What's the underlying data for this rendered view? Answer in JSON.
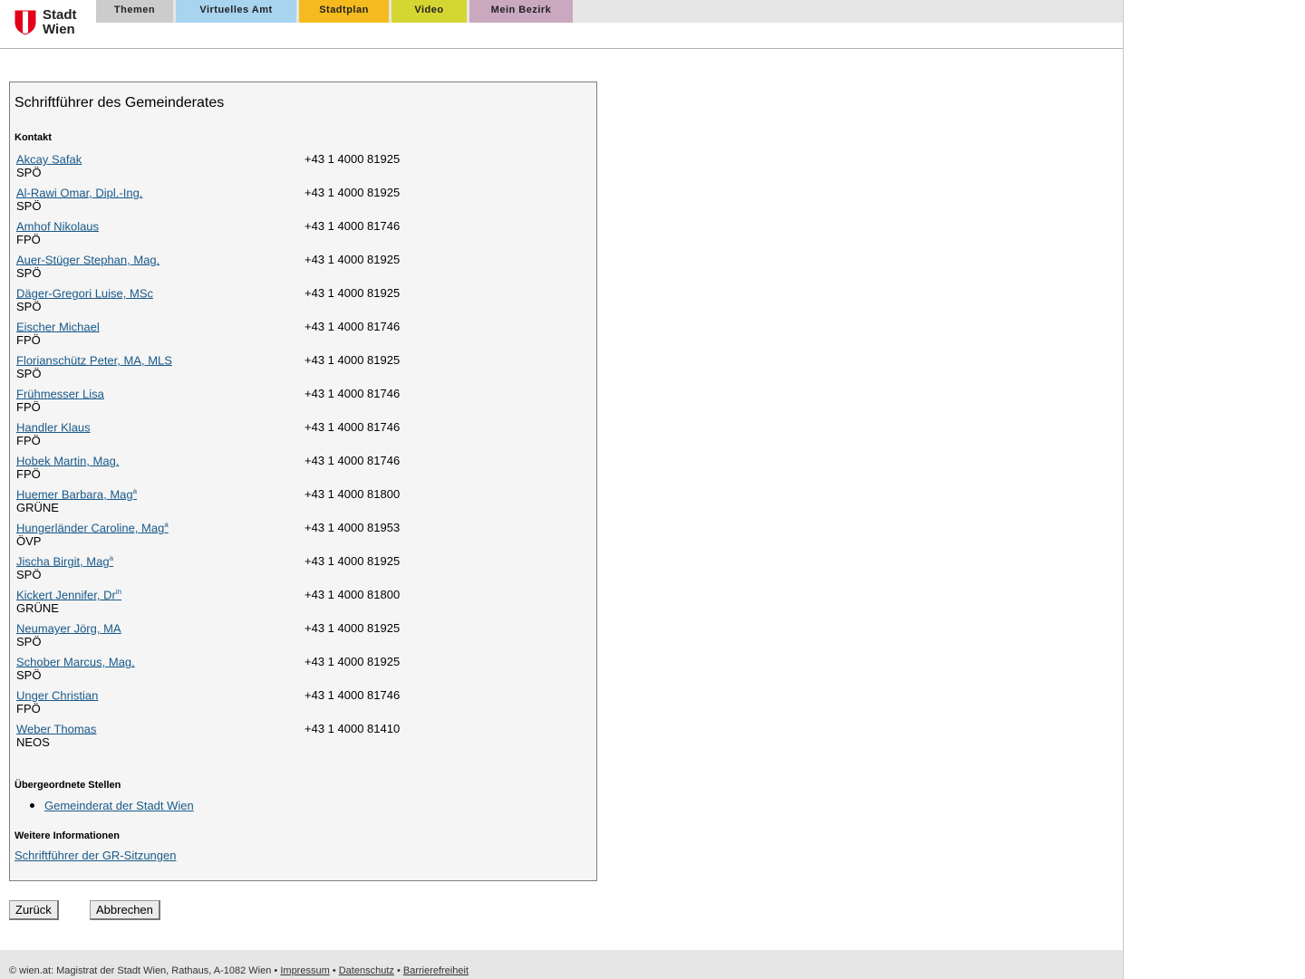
{
  "header": {
    "logo_line1": "Stadt",
    "logo_line2": "Wien",
    "nav": [
      {
        "label": "Themen",
        "color": "#cccccc"
      },
      {
        "label": "Virtuelles Amt",
        "color": "#a8d4f0"
      },
      {
        "label": "Stadtplan",
        "color": "#f5bb1e"
      },
      {
        "label": "Video",
        "color": "#d6d633"
      },
      {
        "label": "Mein Bezirk",
        "color": "#c9a8c0"
      }
    ]
  },
  "main": {
    "title": "Schriftführer des Gemeinderates",
    "contact_heading": "Kontakt",
    "people": [
      {
        "name": "Akcay Safak",
        "sup": "",
        "party": "SPÖ",
        "phone": "+43 1 4000 81925"
      },
      {
        "name": "Al-Rawi Omar, Dipl.-Ing.",
        "sup": "",
        "party": "SPÖ",
        "phone": "+43 1 4000 81925"
      },
      {
        "name": "Amhof Nikolaus",
        "sup": "",
        "party": "FPÖ",
        "phone": "+43 1 4000 81746"
      },
      {
        "name": "Auer-Stüger Stephan, Mag.",
        "sup": "",
        "party": "SPÖ",
        "phone": "+43 1 4000 81925"
      },
      {
        "name": "Däger-Gregori Luise, MSc",
        "sup": "",
        "party": "SPÖ",
        "phone": "+43 1 4000 81925"
      },
      {
        "name": "Eischer Michael",
        "sup": "",
        "party": "FPÖ",
        "phone": "+43 1 4000 81746"
      },
      {
        "name": "Florianschütz Peter, MA, MLS",
        "sup": "",
        "party": "SPÖ",
        "phone": "+43 1 4000 81925"
      },
      {
        "name": "Frühmesser Lisa",
        "sup": "",
        "party": "FPÖ",
        "phone": "+43 1 4000 81746"
      },
      {
        "name": "Handler Klaus",
        "sup": "",
        "party": "FPÖ",
        "phone": "+43 1 4000 81746"
      },
      {
        "name": "Hobek Martin, Mag.",
        "sup": "",
        "party": "FPÖ",
        "phone": "+43 1 4000 81746"
      },
      {
        "name": "Huemer Barbara, Mag",
        "sup": "a",
        "party": "GRÜNE",
        "phone": "+43 1 4000 81800"
      },
      {
        "name": "Hungerländer Caroline, Mag",
        "sup": "a",
        "party": "ÖVP",
        "phone": "+43 1 4000 81953"
      },
      {
        "name": "Jischa Birgit, Mag",
        "sup": "a",
        "party": "SPÖ",
        "phone": "+43 1 4000 81925"
      },
      {
        "name": "Kickert Jennifer, Dr",
        "sup": "in",
        "party": "GRÜNE",
        "phone": "+43 1 4000 81800"
      },
      {
        "name": "Neumayer Jörg, MA",
        "sup": "",
        "party": "SPÖ",
        "phone": "+43 1 4000 81925"
      },
      {
        "name": "Schober Marcus, Mag.",
        "sup": "",
        "party": "SPÖ",
        "phone": "+43 1 4000 81925"
      },
      {
        "name": "Unger Christian",
        "sup": "",
        "party": "FPÖ",
        "phone": "+43 1 4000 81746"
      },
      {
        "name": "Weber Thomas",
        "sup": "",
        "party": "NEOS",
        "phone": "+43 1 4000 81410"
      }
    ],
    "parent_heading": "Übergeordnete Stellen",
    "parent_link": "Gemeinderat der Stadt Wien",
    "more_heading": "Weitere Informationen",
    "more_link": "Schriftführer der GR-Sitzungen"
  },
  "buttons": {
    "back": "Zurück",
    "cancel": "Abbrechen"
  },
  "footer": {
    "text": "© wien.at: Magistrat der Stadt Wien, Rathaus, A-1082 Wien",
    "sep": "•",
    "links": [
      "Impressum",
      "Datenschutz",
      "Barrierefreiheit"
    ]
  }
}
